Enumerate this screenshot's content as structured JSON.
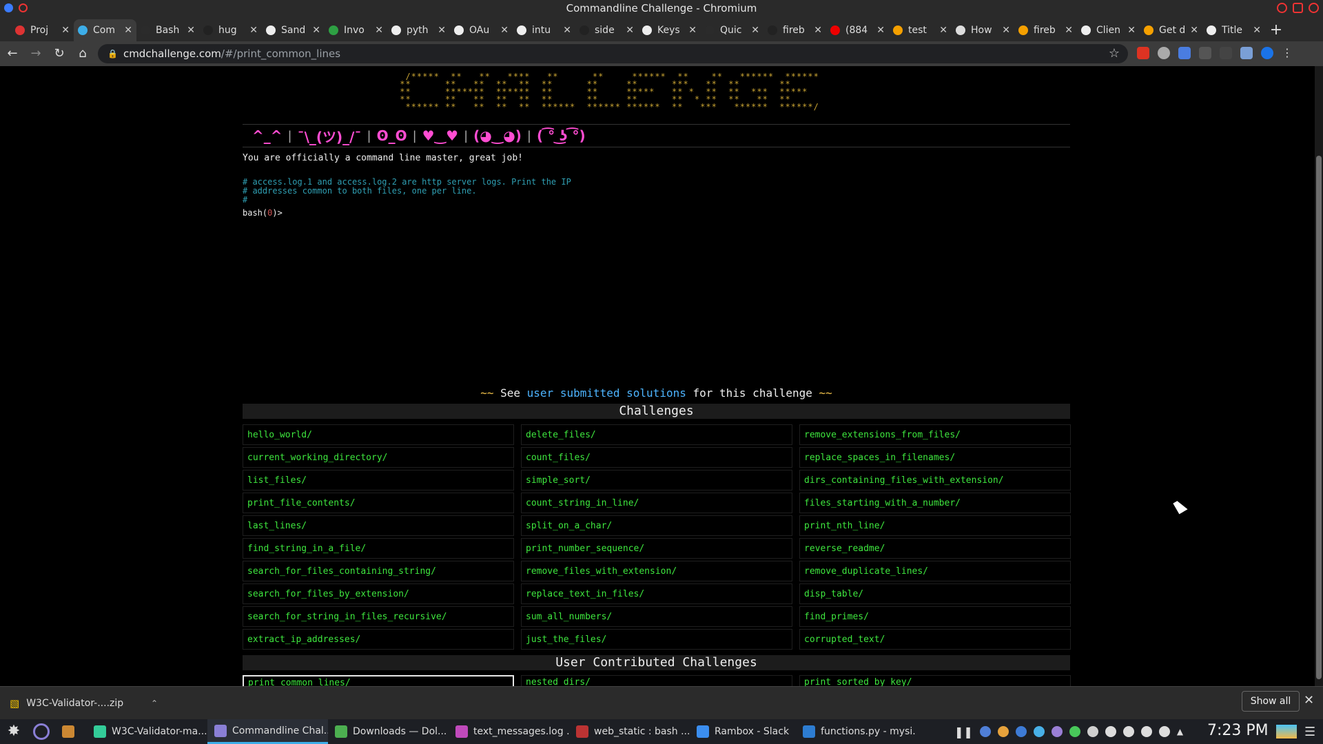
{
  "window": {
    "title": "Commandline Challenge - Chromium"
  },
  "tabs": [
    {
      "label": "Proj",
      "color": "#d33",
      "active": false
    },
    {
      "label": "Com",
      "color": "#3daee9",
      "active": true
    },
    {
      "label": "Bash",
      "color": "#2b2b2b",
      "active": false
    },
    {
      "label": "hug",
      "color": "#222",
      "active": false
    },
    {
      "label": "Sand",
      "color": "#eee",
      "active": false
    },
    {
      "label": "Invo",
      "color": "#2ea043",
      "active": false
    },
    {
      "label": "pyth",
      "color": "#eee",
      "active": false
    },
    {
      "label": "OAu",
      "color": "#eee",
      "active": false
    },
    {
      "label": "intu",
      "color": "#eee",
      "active": false
    },
    {
      "label": "side",
      "color": "#222",
      "active": false
    },
    {
      "label": "Keys",
      "color": "#eee",
      "active": false
    },
    {
      "label": "Quic",
      "color": "#2b2b2b",
      "active": false
    },
    {
      "label": "fireb",
      "color": "#222",
      "active": false
    },
    {
      "label": "(884",
      "color": "#e00",
      "active": false
    },
    {
      "label": "test",
      "color": "#f5a000",
      "active": false
    },
    {
      "label": "How",
      "color": "#ddd",
      "active": false
    },
    {
      "label": "fireb",
      "color": "#f5a000",
      "active": false
    },
    {
      "label": "Clien",
      "color": "#eee",
      "active": false
    },
    {
      "label": "Get d",
      "color": "#f5a000",
      "active": false
    },
    {
      "label": "Title",
      "color": "#eee",
      "active": false
    }
  ],
  "toolbar": {
    "url_host": "cmdchallenge.com",
    "url_path": "/#/print_common_lines"
  },
  "faces": [
    "^_^",
    "¯\\_(ツ)_/¯",
    "ʘ_ʘ",
    "♥‿♥",
    "(◕‿◕)",
    "( ͡° ͜ʖ ͡°)"
  ],
  "terminal": {
    "success": "You are officially a command line master, great job!",
    "comment": "# access.log.1 and access.log.2 are http server logs. Print the IP\n# addresses common to both files, one per line.\n#",
    "prompt_pre": "bash(",
    "prompt_code": "0",
    "prompt_post": ")>"
  },
  "solutions": {
    "tilde_left": "~~",
    "pre": "See",
    "link": "user submitted solutions",
    "post": "for this challenge",
    "tilde_right": "~~"
  },
  "challenges": {
    "heading": "Challenges",
    "items": [
      "hello_world/",
      "delete_files/",
      "remove_extensions_from_files/",
      "current_working_directory/",
      "count_files/",
      "replace_spaces_in_filenames/",
      "list_files/",
      "simple_sort/",
      "dirs_containing_files_with_extension/",
      "print_file_contents/",
      "count_string_in_line/",
      "files_starting_with_a_number/",
      "last_lines/",
      "split_on_a_char/",
      "print_nth_line/",
      "find_string_in_a_file/",
      "print_number_sequence/",
      "reverse_readme/",
      "search_for_files_containing_string/",
      "remove_files_with_extension/",
      "remove_duplicate_lines/",
      "search_for_files_by_extension/",
      "replace_text_in_files/",
      "disp_table/",
      "search_for_string_in_files_recursive/",
      "sum_all_numbers/",
      "find_primes/",
      "extract_ip_addresses/",
      "just_the_files/",
      "corrupted_text/"
    ]
  },
  "user_challenges": {
    "heading": "User Contributed Challenges",
    "items": [
      "print_common_lines/",
      "nested_dirs/",
      "print_sorted_by_key/"
    ],
    "selected": 0
  },
  "downloads": {
    "file": "W3C-Validator-....zip",
    "show_all": "Show all"
  },
  "taskbar": {
    "items": [
      {
        "label": "",
        "color": "#c83",
        "active": false
      },
      {
        "label": "W3C-Validator-ma...",
        "color": "#3c9",
        "active": false
      },
      {
        "label": "Commandline Chal...",
        "color": "#8a7fd6",
        "active": true
      },
      {
        "label": "Downloads — Dol...",
        "color": "#4caf50",
        "active": false
      },
      {
        "label": "text_messages.log ...",
        "color": "#c04abc",
        "active": false
      },
      {
        "label": "web_static : bash ...",
        "color": "#b33",
        "active": false
      },
      {
        "label": "Rambox - Slack",
        "color": "#3b8ef0",
        "active": false
      },
      {
        "label": "functions.py - mysi...",
        "color": "#2d7dd2",
        "active": false
      }
    ],
    "clock": "7:23 PM"
  }
}
